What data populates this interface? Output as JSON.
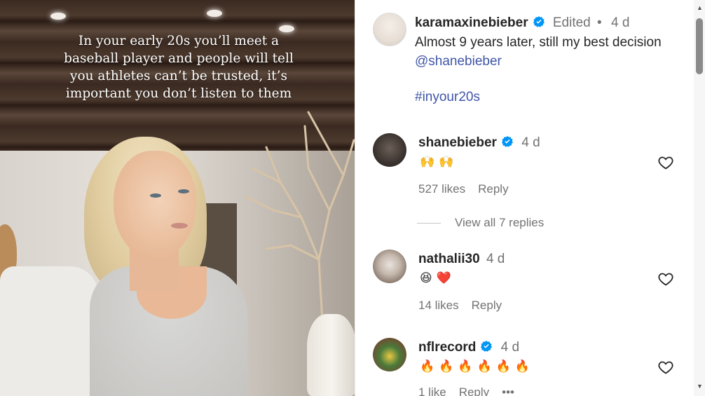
{
  "post": {
    "overlay_text": "In your early 20s you’ll meet a\nbaseball player and people will tell\nyou athletes can’t be trusted, it’s\nimportant you don’t listen to them"
  },
  "caption": {
    "username": "karamaxinebieber",
    "edited": "Edited",
    "dot": "•",
    "time": "4 d",
    "text": "Almost 9 years later, still my best decision ",
    "mention": "@shanebieber",
    "hashtag": "#inyour20s"
  },
  "comments": [
    {
      "username": "shanebieber",
      "verified": true,
      "time": "4 d",
      "emojis": "🙌🙌",
      "likes": "527 likes",
      "reply": "Reply",
      "view_replies": "View all 7 replies"
    },
    {
      "username": "nathalii30",
      "verified": false,
      "time": "4 d",
      "emojis": "😆❤️",
      "likes": "14 likes",
      "reply": "Reply"
    },
    {
      "username": "nflrecord",
      "verified": true,
      "time": "4 d",
      "emojis": "🔥🔥🔥🔥🔥🔥",
      "likes": "1 like",
      "reply": "Reply",
      "more": "•••"
    }
  ],
  "colors": {
    "link": "#4056a8",
    "verified": "#0095f6",
    "muted": "#737373"
  }
}
